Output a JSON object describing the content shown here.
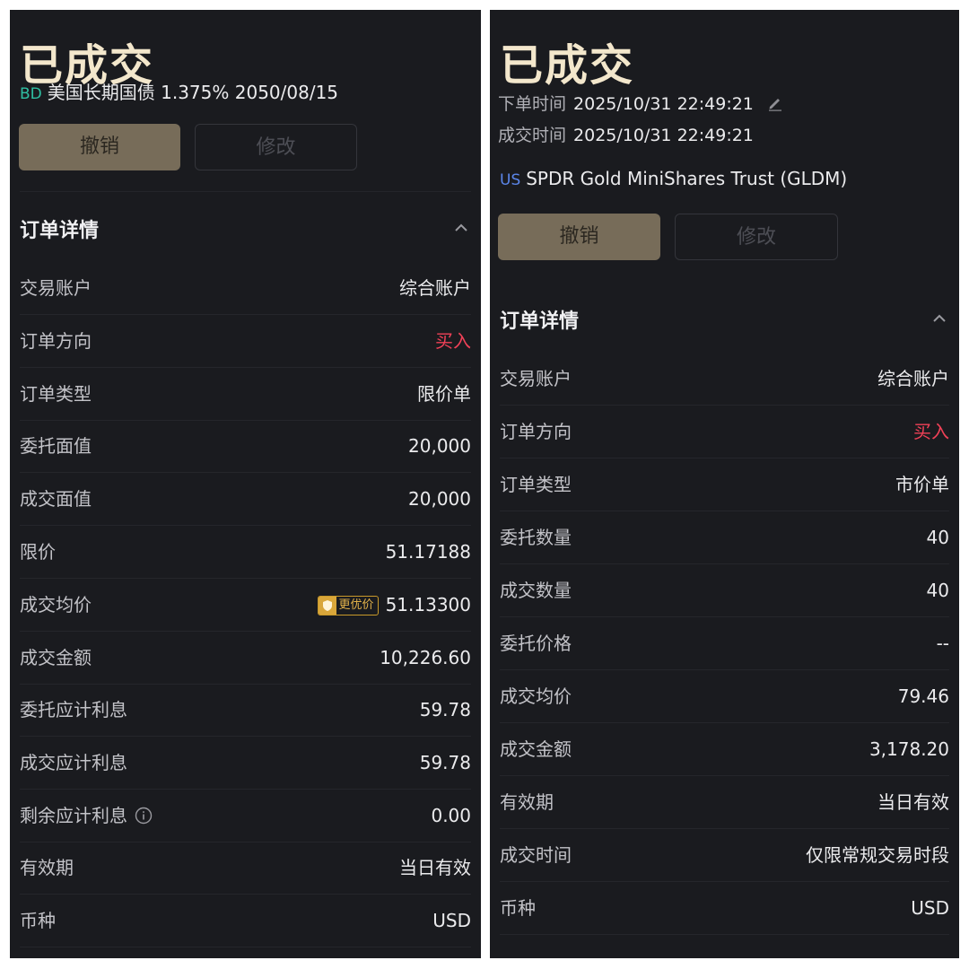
{
  "left": {
    "status_title": "已成交",
    "security": {
      "market": "BD",
      "name": "美国长期国债 1.375% 2050/08/15"
    },
    "buttons": {
      "cancel": "撤销",
      "modify": "修改"
    },
    "section_title": "订单详情",
    "rows": [
      {
        "label": "交易账户",
        "value": "综合账户"
      },
      {
        "label": "订单方向",
        "value": "买入"
      },
      {
        "label": "订单类型",
        "value": "限价单"
      },
      {
        "label": "委托面值",
        "value": "20,000"
      },
      {
        "label": "成交面值",
        "value": "20,000"
      },
      {
        "label": "限价",
        "value": "51.17188"
      },
      {
        "label": "成交均价",
        "value": "51.13300",
        "badge": "更优价"
      },
      {
        "label": "成交金额",
        "value": "10,226.60"
      },
      {
        "label": "委托应计利息",
        "value": "59.78"
      },
      {
        "label": "成交应计利息",
        "value": "59.78"
      },
      {
        "label": "剩余应计利息",
        "value": "0.00"
      },
      {
        "label": "有效期",
        "value": "当日有效"
      },
      {
        "label": "币种",
        "value": "USD"
      }
    ]
  },
  "right": {
    "status_title": "已成交",
    "order_time": {
      "label": "下单时间",
      "value": "2025/10/31 22:49:21"
    },
    "fill_time": {
      "label": "成交时间",
      "value": "2025/10/31 22:49:21"
    },
    "security": {
      "market": "US",
      "name": "SPDR Gold MiniShares Trust (GLDM)"
    },
    "buttons": {
      "cancel": "撤销",
      "modify": "修改"
    },
    "section_title": "订单详情",
    "rows": [
      {
        "label": "交易账户",
        "value": "综合账户"
      },
      {
        "label": "订单方向",
        "value": "买入"
      },
      {
        "label": "订单类型",
        "value": "市价单"
      },
      {
        "label": "委托数量",
        "value": "40"
      },
      {
        "label": "成交数量",
        "value": "40"
      },
      {
        "label": "委托价格",
        "value": "--"
      },
      {
        "label": "成交均价",
        "value": "79.46"
      },
      {
        "label": "成交金额",
        "value": "3,178.20"
      },
      {
        "label": "有效期",
        "value": "当日有效"
      },
      {
        "label": "成交时间",
        "value": "仅限常规交易时段"
      },
      {
        "label": "币种",
        "value": "USD"
      }
    ]
  },
  "colors": {
    "background": "#1a1b1f",
    "title": "#f3e7cc",
    "buy": "#f04157",
    "cancel_button": "#776c59",
    "badge_gold": "#d9a63a"
  }
}
